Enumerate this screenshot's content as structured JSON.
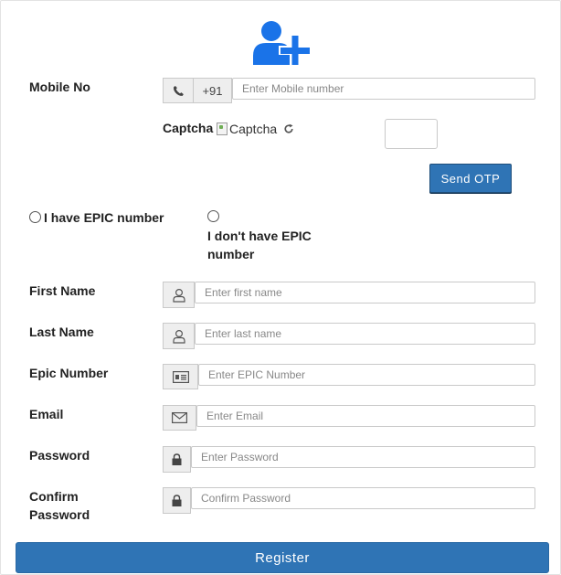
{
  "form": {
    "mobile": {
      "label": "Mobile No",
      "country_code": "+91",
      "placeholder": "Enter Mobile number",
      "value": ""
    },
    "captcha": {
      "label": "Captcha",
      "image_alt": "Captcha",
      "value": ""
    },
    "send_otp_label": "Send OTP",
    "radios": {
      "have_epic": "I have EPIC number",
      "no_epic_line1": "I don't have EPIC",
      "no_epic_line2": "number"
    },
    "first_name": {
      "label": "First Name",
      "placeholder": "Enter first name"
    },
    "last_name": {
      "label": "Last Name",
      "placeholder": "Enter last name"
    },
    "epic_number": {
      "label": "Epic Number",
      "placeholder": "Enter EPIC Number"
    },
    "email": {
      "label": "Email",
      "placeholder": "Enter Email"
    },
    "password": {
      "label": "Password",
      "placeholder": "Enter Password"
    },
    "confirm_password": {
      "label_line1": "Confirm",
      "label_line2": "Password",
      "placeholder": "Confirm Password"
    },
    "register_label": "Register"
  },
  "icons": {
    "header": "add-user-icon",
    "phone": "phone-icon",
    "refresh": "refresh-icon",
    "user": "user-icon",
    "id_card": "id-card-icon",
    "envelope": "envelope-icon",
    "lock": "lock-icon"
  },
  "colors": {
    "accent": "#2f74b5",
    "icon_blue": "#1a73e8"
  }
}
